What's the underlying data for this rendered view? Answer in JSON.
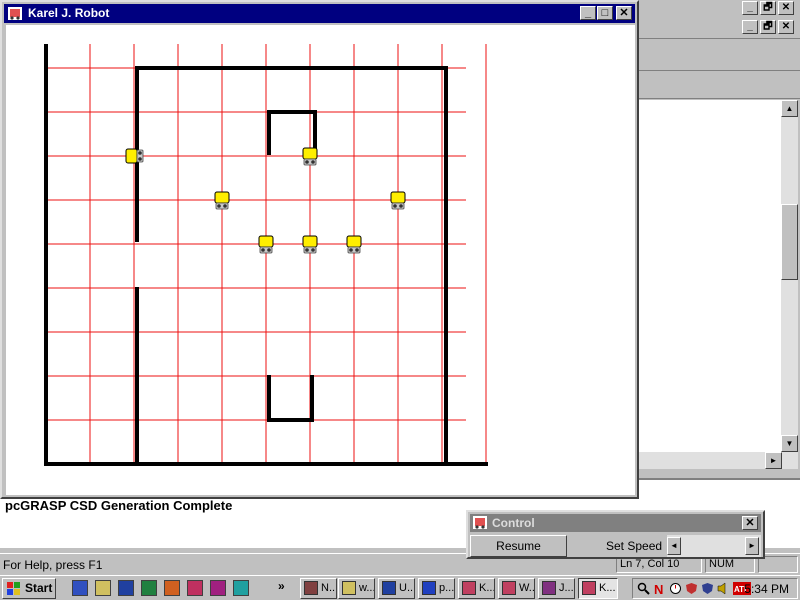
{
  "karel_window": {
    "title": "Karel J. Robot",
    "minimize_label": "_",
    "maximize_label": "□",
    "close_label": "✕"
  },
  "world": {
    "streets": 10,
    "avenues": 10,
    "wall_color": "#000000",
    "grid_color": "#ee1111",
    "robot_color": "#ffee00",
    "robots": [
      {
        "street": 7,
        "avenue": 2,
        "facing": "east"
      },
      {
        "street": 7,
        "avenue": 6,
        "facing": "south"
      },
      {
        "street": 6,
        "avenue": 4,
        "facing": "south"
      },
      {
        "street": 6,
        "avenue": 8,
        "facing": "south"
      },
      {
        "street": 5,
        "avenue": 5,
        "facing": "south"
      },
      {
        "street": 5,
        "avenue": 6,
        "facing": "south"
      },
      {
        "street": 5,
        "avenue": 7,
        "facing": "south"
      }
    ]
  },
  "ide": {
    "output_message": "pcGRASP CSD Generation Complete",
    "status_help": "For Help, press F1",
    "status_position": "Ln 7, Col 10",
    "status_num": "NUM",
    "scroll_up": "▲",
    "scroll_down": "▼",
    "scroll_right": "►",
    "restore_label": "🗗",
    "minimize_label": "_",
    "close_label": "✕"
  },
  "control": {
    "title": "Control",
    "resume_label": "Resume",
    "speed_label": "Set Speed",
    "speed_left": "◄",
    "speed_right": "►",
    "close_label": "✕"
  },
  "taskbar": {
    "start_label": "Start",
    "overflow": "»",
    "tasks": [
      "N...",
      "w...",
      "U...",
      "p...",
      "K...",
      "W...",
      "J...",
      "K..."
    ],
    "clock": "5:34 PM"
  }
}
